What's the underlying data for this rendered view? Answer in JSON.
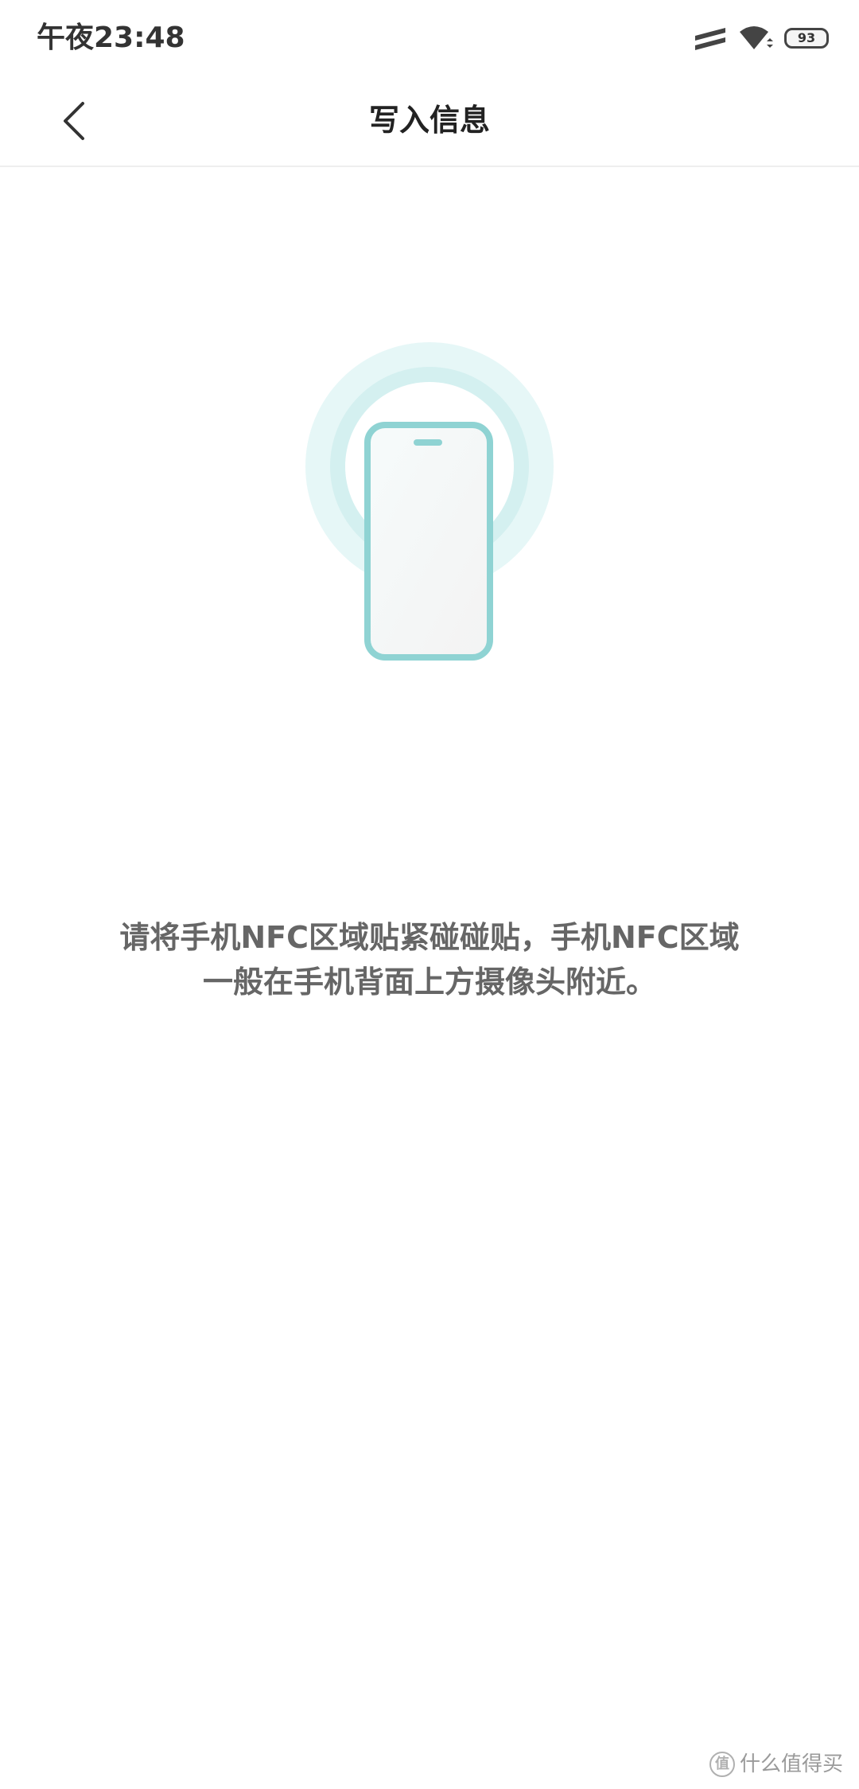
{
  "status_bar": {
    "time": "午夜23:48",
    "battery_level": "93",
    "icons": [
      "signal-icon",
      "wifi-icon",
      "battery-icon"
    ]
  },
  "header": {
    "back_icon": "chevron-left-icon",
    "title": "写入信息"
  },
  "illustration": {
    "icon": "phone-nfc-icon",
    "accent_color": "#8fd3d3",
    "halo_color": "#e4f6f6"
  },
  "instruction": {
    "line1": "请将手机NFC区域贴紧碰碰贴，手机NFC区域",
    "line2": "一般在手机背面上方摄像头附近。"
  },
  "watermark": {
    "logo_glyph": "值",
    "text": "什么值得买"
  }
}
